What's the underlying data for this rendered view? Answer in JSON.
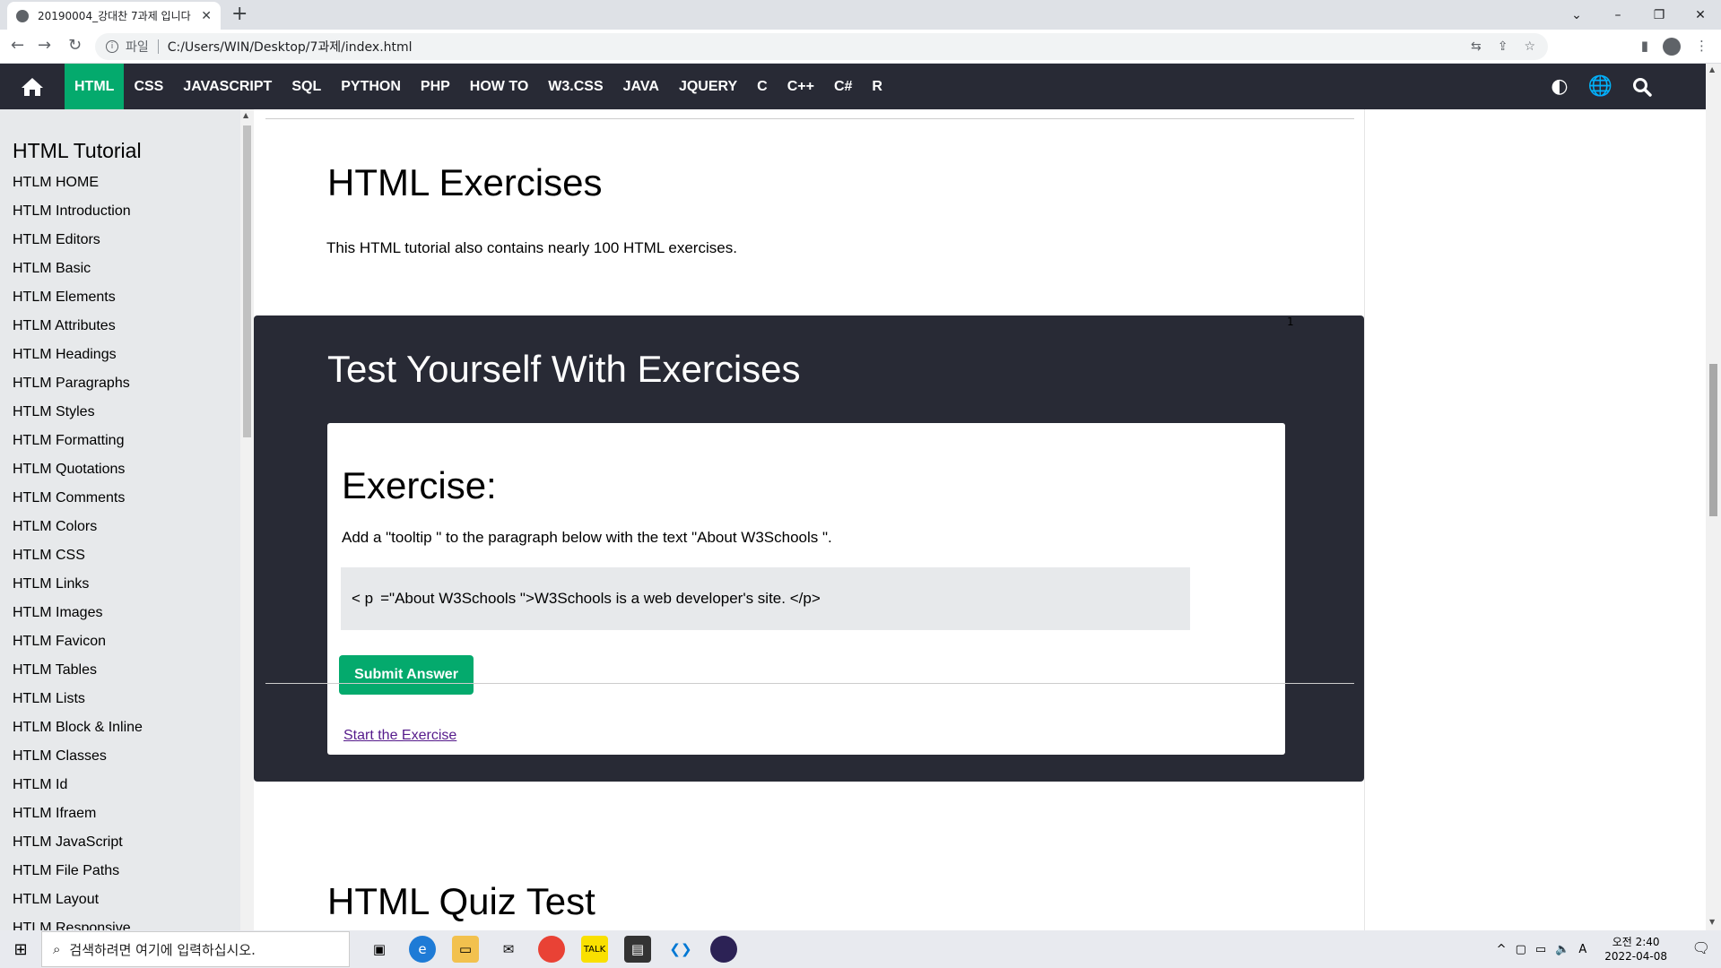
{
  "browser": {
    "tab_title": "20190004_강대찬 7과제 입니다",
    "address_scheme": "파일",
    "address_url": "C:/Users/WIN/Desktop/7과제/index.html"
  },
  "topnav": {
    "items": [
      {
        "label": "HTML",
        "active": true
      },
      {
        "label": "CSS"
      },
      {
        "label": "JAVASCRIPT"
      },
      {
        "label": "SQL"
      },
      {
        "label": "PYTHON"
      },
      {
        "label": "PHP"
      },
      {
        "label": "HOW TO"
      },
      {
        "label": "W3.CSS"
      },
      {
        "label": "JAVA"
      },
      {
        "label": "JQUERY"
      },
      {
        "label": "C"
      },
      {
        "label": "C++"
      },
      {
        "label": "C#"
      },
      {
        "label": "R"
      }
    ]
  },
  "sidebar": {
    "title": "HTML Tutorial",
    "items": [
      "HTLM HOME",
      "HTLM Introduction",
      "HTLM Editors",
      "HTLM Basic",
      "HTLM Elements",
      "HTLM Attributes",
      "HTLM Headings",
      "HTLM Paragraphs",
      "HTLM Styles",
      "HTLM Formatting",
      "HTLM Quotations",
      "HTLM Comments",
      "HTLM Colors",
      "HTLM CSS",
      "HTLM Links",
      "HTLM Images",
      "HTLM Favicon",
      "HTLM Tables",
      "HTLM Lists",
      "HTLM Block & Inline",
      "HTLM Classes",
      "HTLM Id",
      "HTLM Ifraem",
      "HTLM JavaScript",
      "HTLM File Paths",
      "HTLM Layout",
      "HTLM Responsive"
    ]
  },
  "main": {
    "exercises_title": "HTML Exercises",
    "exercises_desc": "This HTML tutorial also contains nearly 100 HTML exercises.",
    "panel_marker": "1",
    "panel_title": "Test Yourself With Exercises",
    "exercise": {
      "heading": "Exercise:",
      "instruction": "Add a \"tooltip \" to the paragraph below with the text \"About W3Schools \".",
      "code_before": "< p",
      "code_after": "=\"About W3Schools \">W3Schools is a web developer's site. </p>",
      "submit_label": "Submit Answer",
      "start_link": "Start the Exercise"
    },
    "quiz_title": "HTML Quiz Test"
  },
  "taskbar": {
    "search_placeholder": "검색하려면 여기에 입력하십시오.",
    "ime": "A",
    "time": "오전 2:40",
    "date": "2022-04-08"
  },
  "colors": {
    "nav_bg": "#282a35",
    "accent_green": "#04aa6d",
    "sidebar_bg": "#e7e9eb"
  }
}
